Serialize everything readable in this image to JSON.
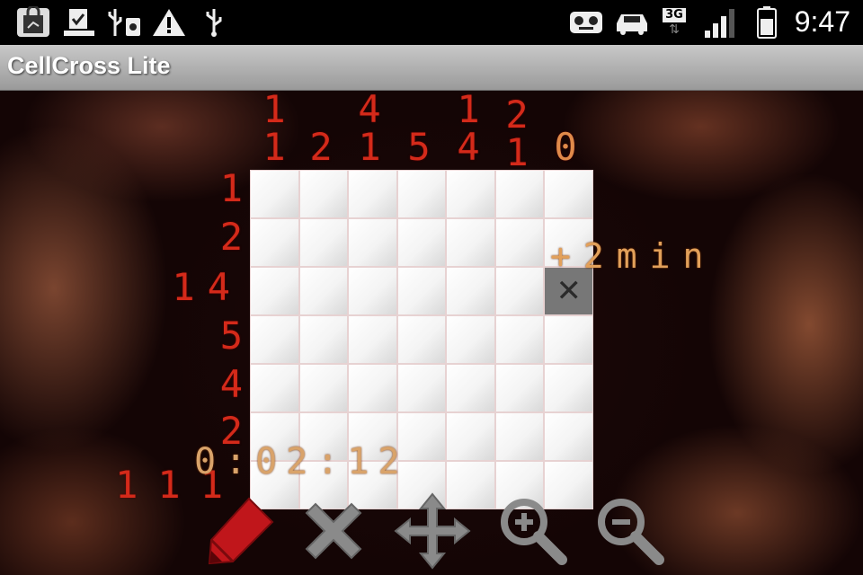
{
  "status_bar": {
    "time": "9:47",
    "network_label": "3G",
    "icons": [
      "shopping-bag-icon",
      "download-complete-icon",
      "usb-debug-icon",
      "warning-icon",
      "usb-icon",
      "voicemail-icon",
      "car-mode-icon",
      "signal-3g-icon",
      "battery-icon"
    ]
  },
  "app": {
    "title": "CellCross Lite"
  },
  "puzzle": {
    "column_clues": [
      [
        "1",
        "1"
      ],
      [
        "2"
      ],
      [
        "4",
        "1"
      ],
      [
        "5"
      ],
      [
        "1",
        "4"
      ],
      [
        "2",
        "1"
      ],
      [
        "0"
      ]
    ],
    "row_clues": [
      [
        "1"
      ],
      [
        "2"
      ],
      [
        "1",
        "4"
      ],
      [
        "5"
      ],
      [
        "4"
      ],
      [
        "2"
      ],
      [
        "1",
        "1",
        "1"
      ]
    ],
    "cells": [
      [
        0,
        0,
        0,
        0,
        0,
        0,
        0
      ],
      [
        0,
        0,
        0,
        0,
        0,
        0,
        0
      ],
      [
        0,
        0,
        0,
        0,
        0,
        0,
        "x"
      ],
      [
        0,
        0,
        0,
        0,
        0,
        0,
        0
      ],
      [
        0,
        0,
        0,
        0,
        0,
        0,
        0
      ],
      [
        0,
        0,
        0,
        0,
        0,
        0,
        0
      ],
      [
        0,
        0,
        0,
        0,
        0,
        0,
        0
      ]
    ],
    "timer": "0:02:12",
    "bonus": "+2min",
    "crossed_mark": "✕"
  },
  "toolbar": {
    "tools": [
      {
        "name": "pencil-tool",
        "icon": "pencil-icon",
        "color": "#c0161b"
      },
      {
        "name": "cross-tool",
        "icon": "cross-icon",
        "color": "#8a8a8a"
      },
      {
        "name": "move-tool",
        "icon": "move-arrows-icon",
        "color": "#8a8a8a"
      },
      {
        "name": "zoom-in-tool",
        "icon": "zoom-in-icon",
        "color": "#8a8a8a"
      },
      {
        "name": "zoom-out-tool",
        "icon": "zoom-out-icon",
        "color": "#8a8a8a"
      }
    ]
  },
  "colors": {
    "clue_red": "#d42a1a",
    "timer_orange": "#d9a36a",
    "crossed_cell": "#777777"
  }
}
